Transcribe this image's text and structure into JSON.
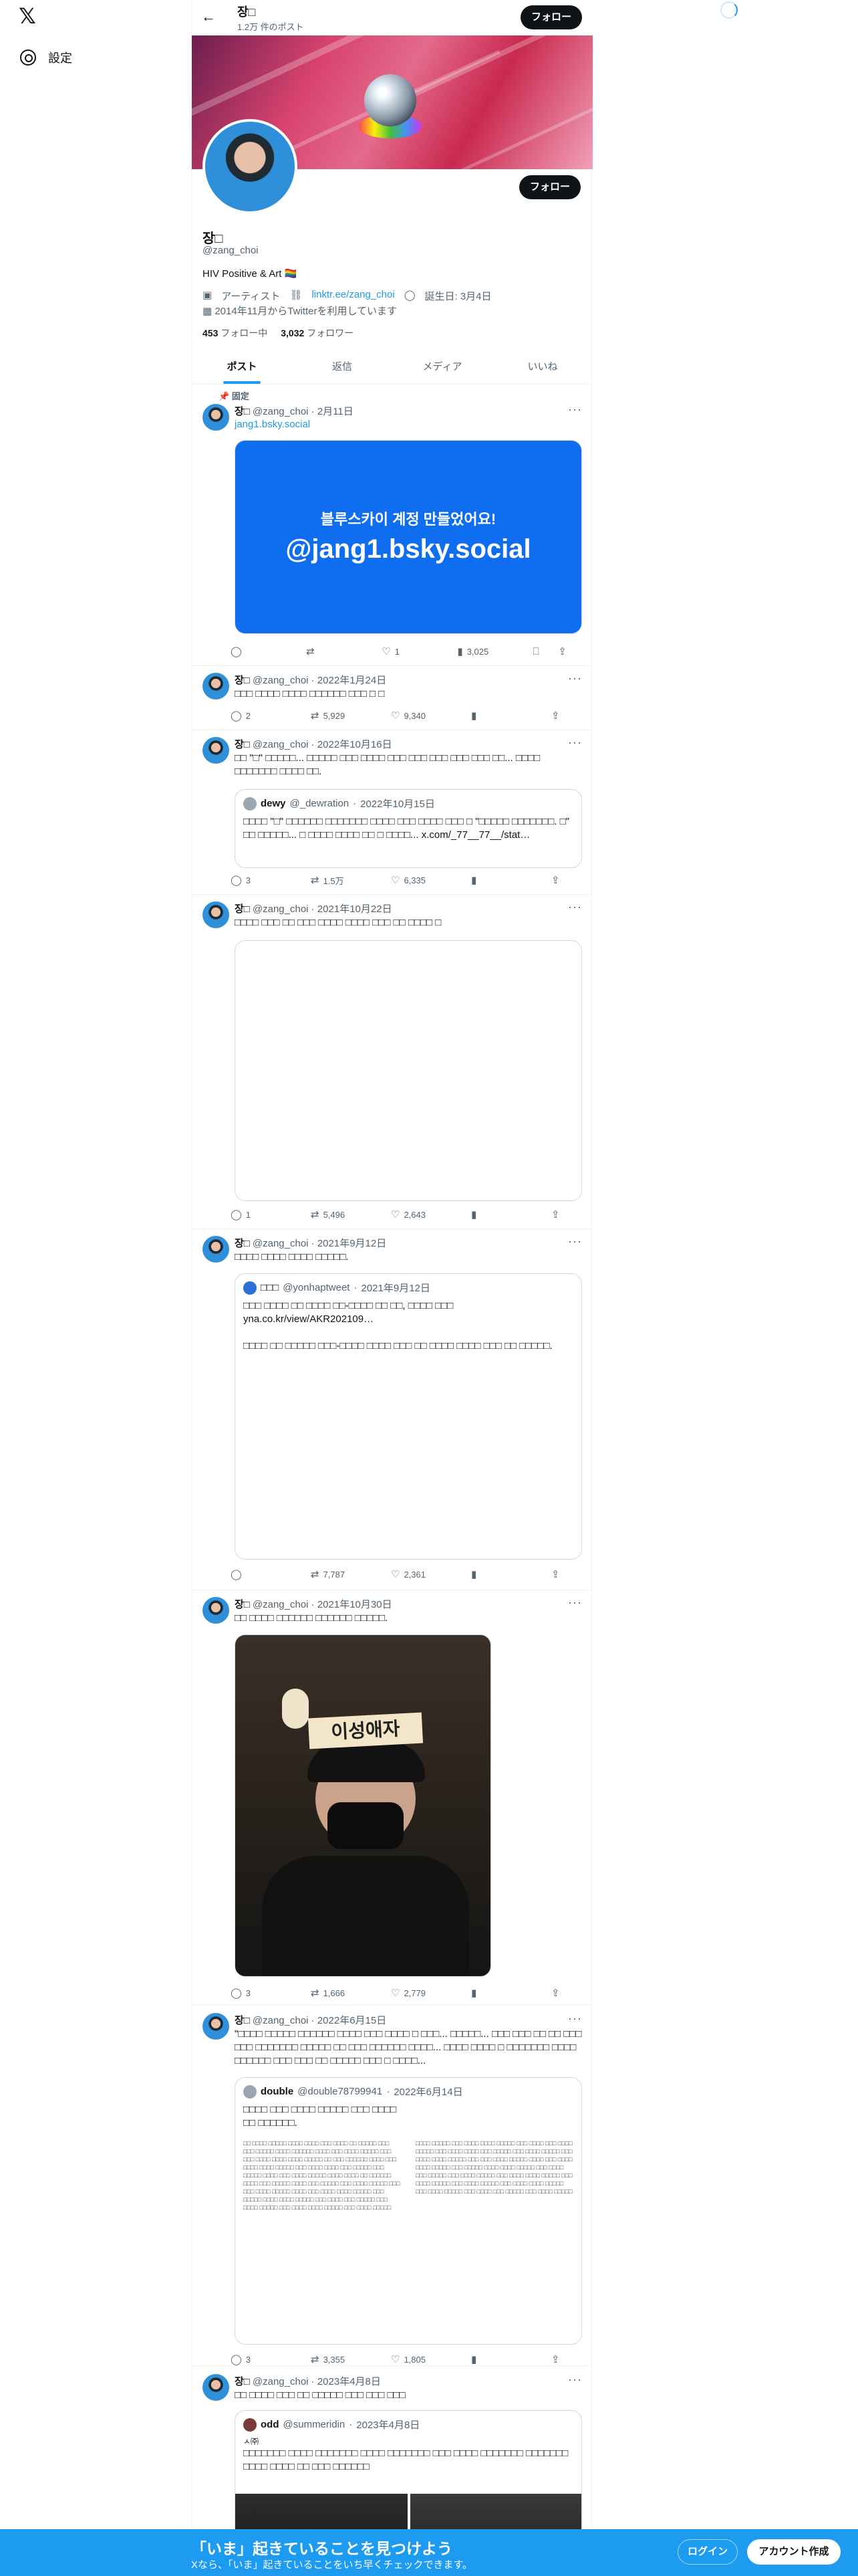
{
  "nav": {
    "logo": "𝕏",
    "settings_label": "設定"
  },
  "header": {
    "name": "장□",
    "post_count": "1.2万 件のポスト",
    "follow_label": "フォロー"
  },
  "profile": {
    "name": "장□",
    "handle": "@zang_choi",
    "bio": "HIV Positive & Art 🏳️‍🌈",
    "category": "アーティスト",
    "link": "linktr.ee/zang_choi",
    "birthday": "誕生日: 3月4日",
    "joined": "2014年11月からTwitterを利用しています",
    "following_count": "453",
    "following_label": "フォロー中",
    "followers_count": "3,032",
    "followers_label": "フォロワー",
    "follow_label": "フォロー"
  },
  "tabs": [
    "ポスト",
    "返信",
    "メディア",
    "いいね"
  ],
  "tweets": [
    {
      "pinned": "固定",
      "author": "장□",
      "handle": "@zang_choi",
      "date": "2月11日",
      "link": "jang1.bsky.social",
      "media_line1": "블루스카이 계정 만들었어요!",
      "media_line2": "@jang1.bsky.social",
      "reply": "",
      "retweet": "",
      "like": "1",
      "views": "3,025"
    },
    {
      "author": "장□",
      "handle": "@zang_choi",
      "date": "2022年1月24日",
      "text": "□□□ □□□□ □□□□ □□□□□□ □□□ □ □",
      "reply": "2",
      "retweet": "5,929",
      "like": "9,340",
      "views": ""
    },
    {
      "author": "장□",
      "handle": "@zang_choi",
      "date": "2022年10月16日",
      "text": "□□ \"□\" □□□□□... □□□□□ □□□ □□□□ □□□ □□□ □□□ □□□ □□□ □□... □□□□ □□□□□□□ □□□□ □□.",
      "quote_author": "dewy",
      "quote_handle": "@_dewration",
      "quote_date": "2022年10月15日",
      "quote_text": "□□□□ \"□\" □□□□□□ □□□□□□□ □□□□ □□□ □□□□ □□□ □ \"□□□□□ □□□□□□□. □\" □□ □□□□□... □ □□□□ □□□□ □□ □ □□□□... x.com/_77__77__/stat…",
      "reply": "3",
      "retweet": "1.5万",
      "like": "6,335",
      "views": ""
    },
    {
      "author": "장□",
      "handle": "@zang_choi",
      "date": "2021年10月22日",
      "text": "□□□□ □□□ □□ □□□ □□□□ □□□□ □□□ □□ □□□□ □",
      "reply": "1",
      "retweet": "5,496",
      "like": "2,643",
      "views": ""
    },
    {
      "author": "장□",
      "handle": "@zang_choi",
      "date": "2021年9月12日",
      "text": "□□□□ □□□□ □□□□ □□□□□.",
      "quote_author": "□□□",
      "quote_handle": "@yonhaptweet",
      "quote_date": "2021年9月12日",
      "quote_text": "□□□ □□□□ □□ □□□□ □□-□□□□ □□ □□, □□□□ □□□",
      "quote_link": "yna.co.kr/view/AKR202109…",
      "quote_text2": "□□□□ □□ □□□□□ □□□-□□□□ □□□□ □□□ □□ □□□□ □□□□ □□□ □□ □□□□□.",
      "reply": "",
      "retweet": "7,787",
      "like": "2,361",
      "views": ""
    },
    {
      "author": "장□",
      "handle": "@zang_choi",
      "date": "2021年10月30日",
      "text": "□□ □□□□ □□□□□□ □□□□□□ □□□□□.",
      "photo_sign": "이성애자",
      "reply": "3",
      "retweet": "1,666",
      "like": "2,779",
      "views": ""
    },
    {
      "author": "장□",
      "handle": "@zang_choi",
      "date": "2022年6月15日",
      "text": "\"□□□□ □□□□□ □□□□□□ □□□□ □□□ □□□□ □ □□□...  □□□□□... □□□ □□□ □□ □□ □□□ □□□ □□□□□□□ □□□□□ □□ □□□ □□□□□□ □□□□... □□□□ □□□□ □ □□□□□□□ □□□□ □□□□□□ □□□ □□□ □□ □□□□□ □□□ □ □□□□...",
      "quote_author": "double",
      "quote_handle": "@double78799941",
      "quote_date": "2022年6月14日",
      "quote_text": "□□□□ □□□ □□□□ □□□□□ □□□ □□□□ □□ □□□□□□.",
      "reply": "3",
      "retweet": "3,355",
      "like": "1,805",
      "views": ""
    },
    {
      "author": "장□",
      "handle": "@zang_choi",
      "date": "2023年4月8日",
      "text": "□□ □□□□ □□□ □□ □□□□□ □□□ □□□ □□□",
      "quote_author": "odd",
      "quote_handle": "@summeridin",
      "quote_date": "2023年4月8日",
      "quote_text": "ㅅ㈜",
      "quote_text2": "□□□□□□□ □□□□ □□□□□□□ □□□□ □□□□□□□ □□□ □□□□ □□□□□□□ □□□□□□□ □□□□ □□□□ □□ □□□ □□□□□□"
    }
  ],
  "bottom": {
    "title": "「いま」起きていることを見つけよう",
    "subtitle": "Xなら、「いま」起きていることをいち早くチェックできます。",
    "login": "ログイン",
    "signup": "アカウント作成"
  }
}
